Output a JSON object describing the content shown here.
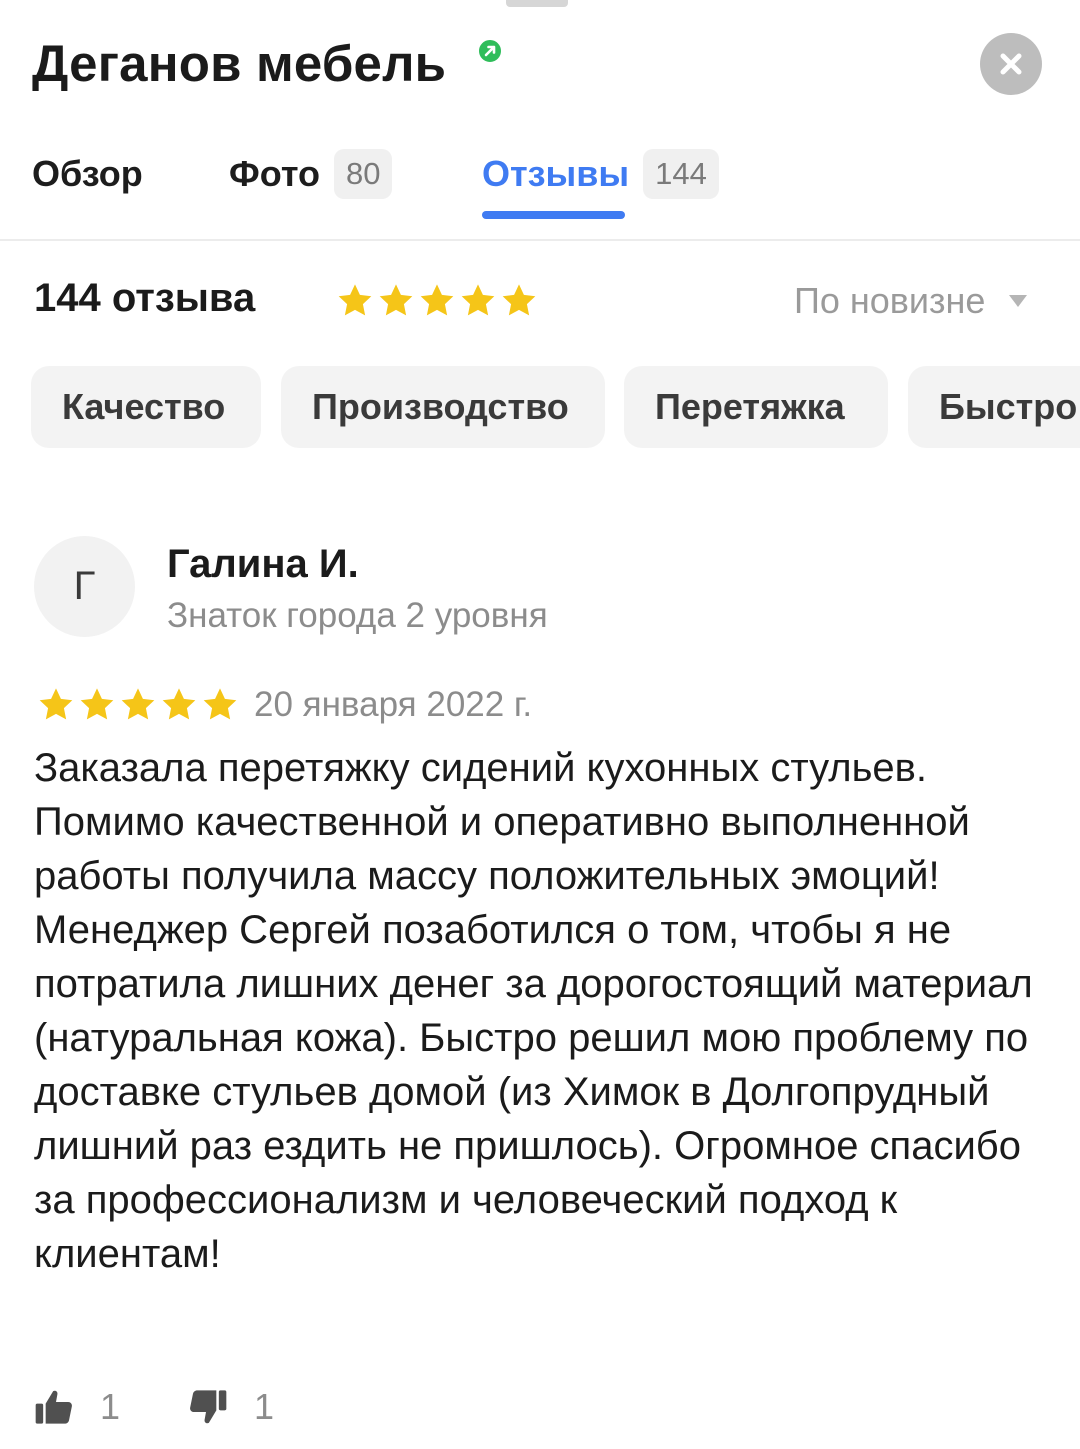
{
  "header": {
    "title": "Деганов мебель",
    "verified_icon": "verified-badge-icon",
    "close_icon": "close-icon"
  },
  "tabs": [
    {
      "label": "Обзор",
      "count": ""
    },
    {
      "label": "Фото",
      "count": "80"
    },
    {
      "label": "Отзывы",
      "count": "144",
      "active": true
    }
  ],
  "summary": {
    "count_label": "144 отзыва",
    "rating_stars": 5,
    "sort_label": "По новизне",
    "sort_icon": "caret-down-icon"
  },
  "chips": [
    "Качество",
    "Производство",
    "Перетяжка",
    "Быстро"
  ],
  "review": {
    "avatar_letter": "Г",
    "author": "Галина И.",
    "author_level": "Знаток города 2 уровня",
    "rating": 5,
    "date": "20 января 2022 г.",
    "text": "Заказала перетяжку сидений кухонных стульев. Помимо качественной и оперативно выполненной работы получила массу положительных эмоций! Менеджер Сергей позаботился о том, чтобы я не потратила лишних денег за дорогостоящий материал (натуральная кожа). Быстро решил мою проблему по доставке стульев домой (из Химок в Долгопрудный лишний раз ездить не пришлось). Огромное спасибо за профессионализм и человеческий подход к клиентам!",
    "likes": "1",
    "dislikes": "1",
    "like_icon": "thumbs-up-icon",
    "dislike_icon": "thumbs-down-icon"
  },
  "colors": {
    "accent": "#3f7bf2",
    "star": "#f5c518",
    "verified": "#2fbd5a",
    "muted_text": "#8c8c8c"
  }
}
